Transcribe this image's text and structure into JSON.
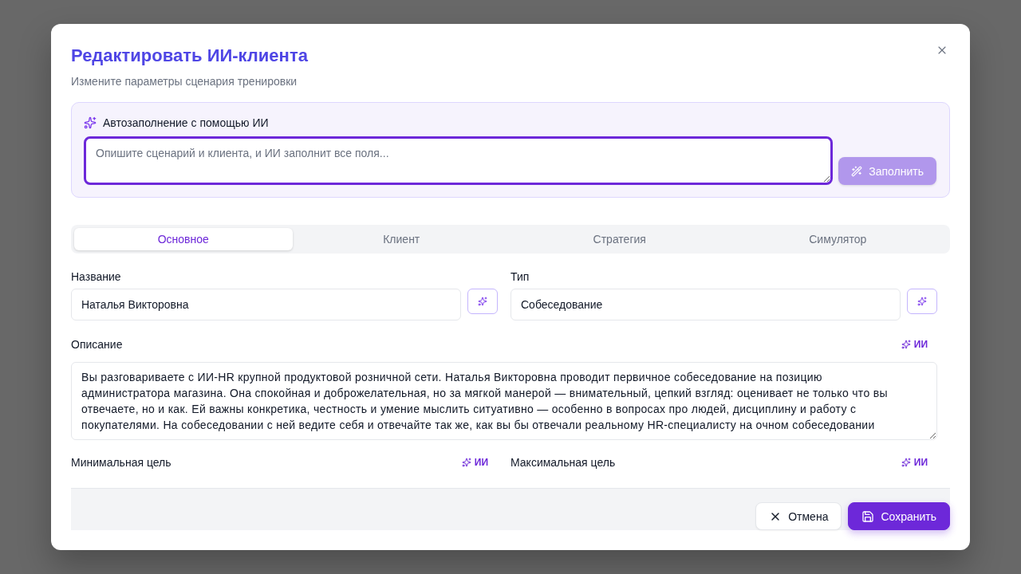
{
  "dialog": {
    "title": "Редактировать ИИ-клиента",
    "subtitle": "Измените параметры сценария тренировки"
  },
  "ai_autofill": {
    "label": "Автозаполнение с помощью ИИ",
    "placeholder": "Опишите сценарий и клиента, и ИИ заполнит все поля...",
    "focused": true,
    "button": {
      "label": "Заполнить",
      "disabled": true
    }
  },
  "tabs": [
    {
      "label": "Основное",
      "selected": true
    },
    {
      "label": "Клиент",
      "selected": false
    },
    {
      "label": "Стратегия",
      "selected": false
    },
    {
      "label": "Симулятор",
      "selected": false
    }
  ],
  "form": {
    "rows": [
      {
        "fields": [
          {
            "kind": "input",
            "label": "Название",
            "value": "Наталья Викторовна"
          },
          {
            "kind": "input",
            "label": "Тип",
            "value": "Собеседование"
          }
        ]
      },
      {
        "fields": [
          {
            "kind": "textarea",
            "label": "Описание",
            "ai_label": "ИИ",
            "value": "Вы разговариваете с ИИ-HR крупной продуктовой розничной сети. Наталья Викторовна проводит первичное собеседование на позицию администратора магазина. Она спокойная и доброжелательная, но за мягкой манерой — внимательный, цепкий взгляд: оценивает не только что вы отвечаете, но и как. Ей важны конкретика, честность и умение мыслить ситуативно — особенно в вопросах про людей, дисциплину и работу с покупателями. На собеседовании с ней ведите себя и отвечайте так же, как вы бы отвечали реальному HR-специалисту на очном собеседовании"
          }
        ]
      },
      {
        "fields": [
          {
            "kind": "heading",
            "label": "Минимальная цель",
            "ai_label": "ИИ"
          },
          {
            "kind": "heading",
            "label": "Максимальная цель",
            "ai_label": "ИИ"
          }
        ]
      }
    ]
  },
  "footer": {
    "buttons": [
      {
        "kind": "cancel",
        "label": "Отмена"
      },
      {
        "kind": "save",
        "label": "Сохранить"
      }
    ]
  }
}
